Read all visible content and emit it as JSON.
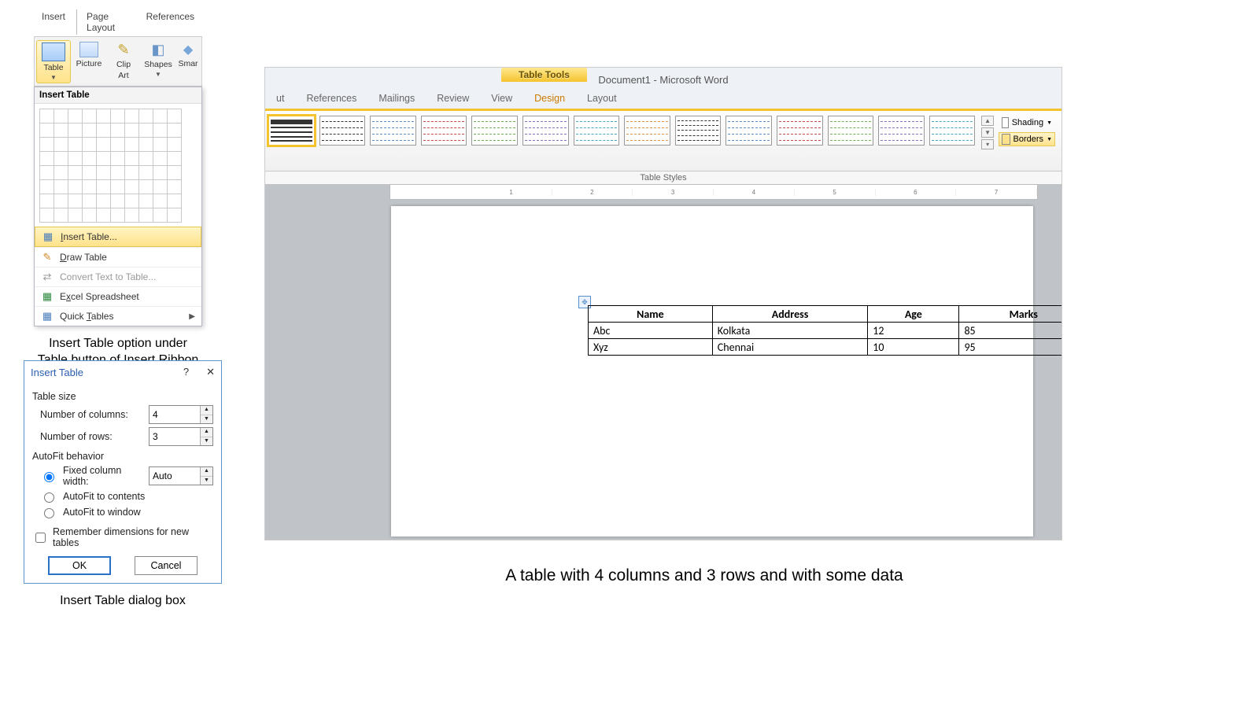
{
  "panel1": {
    "menu_tabs": [
      "Insert",
      "Page Layout",
      "References"
    ],
    "ribbon_buttons": {
      "table": "Table",
      "picture": "Picture",
      "clipart_l1": "Clip",
      "clipart_l2": "Art",
      "shapes": "Shapes",
      "smart_cut": "Smar"
    },
    "dropdown_title": "Insert Table",
    "dd_items": {
      "insert_table": "Insert Table...",
      "draw_table": "Draw Table",
      "convert": "Convert Text to Table...",
      "excel": "Excel Spreadsheet",
      "quick": "Quick Tables"
    },
    "caption": "Insert Table option under Table button of Insert Ribbon"
  },
  "panel2": {
    "title": "Insert Table",
    "sect_size": "Table size",
    "label_cols": "Number of columns:",
    "value_cols": "4",
    "label_rows": "Number of rows:",
    "value_rows": "3",
    "sect_autofit": "AutoFit behavior",
    "opt_fixed": "Fixed column width:",
    "fixed_value": "Auto",
    "opt_contents": "AutoFit to contents",
    "opt_window": "AutoFit to window",
    "remember": "Remember dimensions for new tables",
    "ok": "OK",
    "cancel": "Cancel",
    "caption": "Insert Table dialog box"
  },
  "panel3": {
    "table_tools": "Table Tools",
    "doc_title": "Document1 - Microsoft Word",
    "tabs": {
      "ut": "ut",
      "references": "References",
      "mailings": "Mailings",
      "review": "Review",
      "view": "View",
      "design": "Design",
      "layout": "Layout"
    },
    "ts_label": "Table Styles",
    "shading": "Shading",
    "borders": "Borders",
    "headers": [
      "Name",
      "Address",
      "Age",
      "Marks"
    ],
    "rows": [
      [
        "Abc",
        "Kolkata",
        "12",
        "85"
      ],
      [
        "Xyz",
        "Chennai",
        "10",
        "95"
      ]
    ],
    "ruler": [
      "",
      "1",
      "2",
      "3",
      "4",
      "5",
      "6",
      "7"
    ],
    "caption": "A table with 4 columns and 3 rows and with some data"
  }
}
